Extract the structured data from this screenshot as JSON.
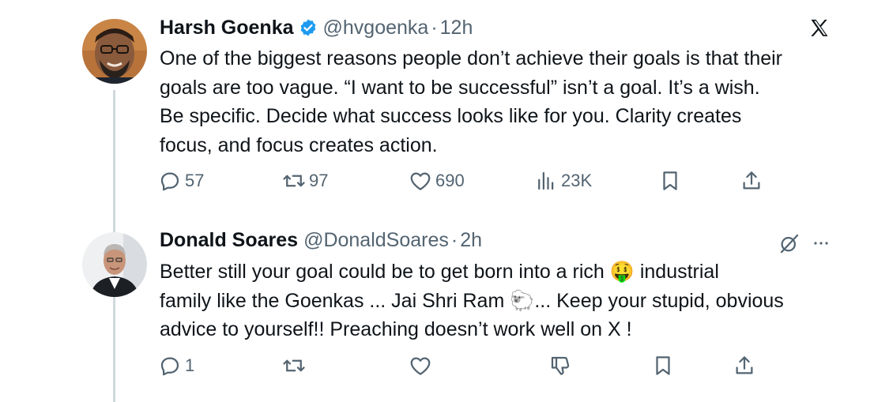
{
  "tweets": [
    {
      "display_name": "Harsh Goenka",
      "handle": "@hvgoenka",
      "separator": "·",
      "time": "12h",
      "text": "One of the biggest reasons people don’t achieve their goals is that their\ngoals are too vague. “I want to be successful” isn’t a goal. It’s a wish.\nBe specific. Decide what success looks like for you. Clarity creates\nfocus, and focus creates action.",
      "replies": "57",
      "reposts": "97",
      "likes": "690",
      "views": "23K"
    },
    {
      "display_name": "Donald Soares",
      "handle": "@DonaldSoares",
      "separator": "·",
      "time": "2h",
      "text": "Better still your goal could be to get born into a rich 🤑 industrial\nfamily like the Goenkas ... Jai Shri Ram 🐑... Keep your stupid, obvious\nadvice to yourself!! Preaching doesn’t work well on X !",
      "replies": "1"
    }
  ],
  "colors": {
    "text": "#0f1419",
    "secondary": "#536471",
    "verified": "#1d9bf0",
    "thread_line": "#cfd9de"
  },
  "icons": [
    "x-logo-icon",
    "verified-badge-icon",
    "reply-icon",
    "repost-icon",
    "like-icon",
    "views-icon",
    "bookmark-icon",
    "share-icon",
    "grok-icon",
    "more-icon",
    "downvote-icon"
  ]
}
